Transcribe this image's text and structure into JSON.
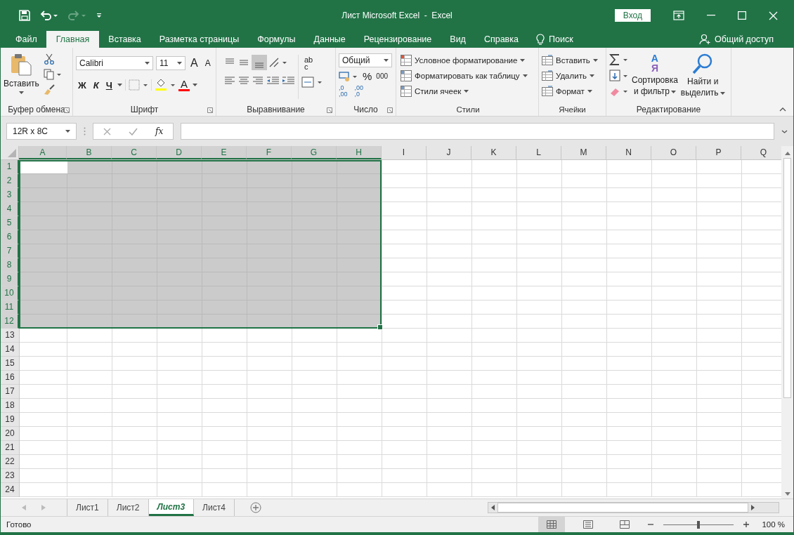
{
  "window": {
    "title": "Лист Microsoft Excel  -  Excel",
    "sign_in": "Вход"
  },
  "tabs": [
    {
      "label": "Файл",
      "selected": false
    },
    {
      "label": "Главная",
      "selected": true
    },
    {
      "label": "Вставка",
      "selected": false
    },
    {
      "label": "Разметка страницы",
      "selected": false
    },
    {
      "label": "Формулы",
      "selected": false
    },
    {
      "label": "Данные",
      "selected": false
    },
    {
      "label": "Рецензирование",
      "selected": false
    },
    {
      "label": "Вид",
      "selected": false
    },
    {
      "label": "Справка",
      "selected": false
    }
  ],
  "search": "Поиск",
  "share": "Общий доступ",
  "clipboard": {
    "paste": "Вставить",
    "label": "Буфер обмена"
  },
  "font": {
    "name": "Calibri",
    "size": "11",
    "grow": "A",
    "shrink": "A",
    "bold": "Ж",
    "italic": "К",
    "underline": "Ч",
    "font_color": "A",
    "label": "Шрифт"
  },
  "alignment": {
    "wrap_top": "ab",
    "wrap_bottom": "c",
    "label": "Выравнивание"
  },
  "number": {
    "format": "Общий",
    "percent": "%",
    "thousands": "000",
    "decimals": [
      {
        "top": ",0",
        "bottom": ",00"
      },
      {
        "top": ",00",
        "bottom": ",0"
      }
    ],
    "label": "Число"
  },
  "styles": {
    "items": [
      "Условное форматирование",
      "Форматировать как таблицу",
      "Стили ячеек"
    ],
    "label": "Стили"
  },
  "cells": {
    "items": [
      "Вставить",
      "Удалить",
      "Формат"
    ],
    "label": "Ячейки"
  },
  "editing": {
    "sort_top": "А",
    "sort_bottom": "Я",
    "sort": [
      "Сортировка",
      "и фильтр"
    ],
    "find": [
      "Найти и",
      "выделить"
    ],
    "label": "Редактирование"
  },
  "formula_bar": {
    "name_box": "12R x 8C",
    "fx": "fx"
  },
  "columns": [
    {
      "label": "A",
      "selected": true
    },
    {
      "label": "B",
      "selected": true
    },
    {
      "label": "C",
      "selected": true
    },
    {
      "label": "D",
      "selected": true
    },
    {
      "label": "E",
      "selected": true
    },
    {
      "label": "F",
      "selected": true
    },
    {
      "label": "G",
      "selected": true
    },
    {
      "label": "H",
      "selected": true
    },
    {
      "label": "I",
      "selected": false
    },
    {
      "label": "J",
      "selected": false
    },
    {
      "label": "K",
      "selected": false
    },
    {
      "label": "L",
      "selected": false
    },
    {
      "label": "M",
      "selected": false
    },
    {
      "label": "N",
      "selected": false
    },
    {
      "label": "O",
      "selected": false
    },
    {
      "label": "P",
      "selected": false
    },
    {
      "label": "Q",
      "selected": false
    }
  ],
  "rows": [
    {
      "label": "1",
      "selected": true
    },
    {
      "label": "2",
      "selected": true
    },
    {
      "label": "3",
      "selected": true
    },
    {
      "label": "4",
      "selected": true
    },
    {
      "label": "5",
      "selected": true
    },
    {
      "label": "6",
      "selected": true
    },
    {
      "label": "7",
      "selected": true
    },
    {
      "label": "8",
      "selected": true
    },
    {
      "label": "9",
      "selected": true
    },
    {
      "label": "10",
      "selected": true
    },
    {
      "label": "11",
      "selected": true
    },
    {
      "label": "12",
      "selected": true
    },
    {
      "label": "13",
      "selected": false
    },
    {
      "label": "14",
      "selected": false
    },
    {
      "label": "15",
      "selected": false
    },
    {
      "label": "16",
      "selected": false
    },
    {
      "label": "17",
      "selected": false
    },
    {
      "label": "18",
      "selected": false
    },
    {
      "label": "19",
      "selected": false
    },
    {
      "label": "20",
      "selected": false
    },
    {
      "label": "21",
      "selected": false
    },
    {
      "label": "22",
      "selected": false
    },
    {
      "label": "23",
      "selected": false
    },
    {
      "label": "24",
      "selected": false
    }
  ],
  "sheets": [
    {
      "label": "Лист1",
      "selected": false
    },
    {
      "label": "Лист2",
      "selected": false
    },
    {
      "label": "Лист3",
      "selected": true
    },
    {
      "label": "Лист4",
      "selected": false
    }
  ],
  "status_bar": {
    "status": "Готово",
    "zoom": "100 %",
    "level": 0.5
  }
}
